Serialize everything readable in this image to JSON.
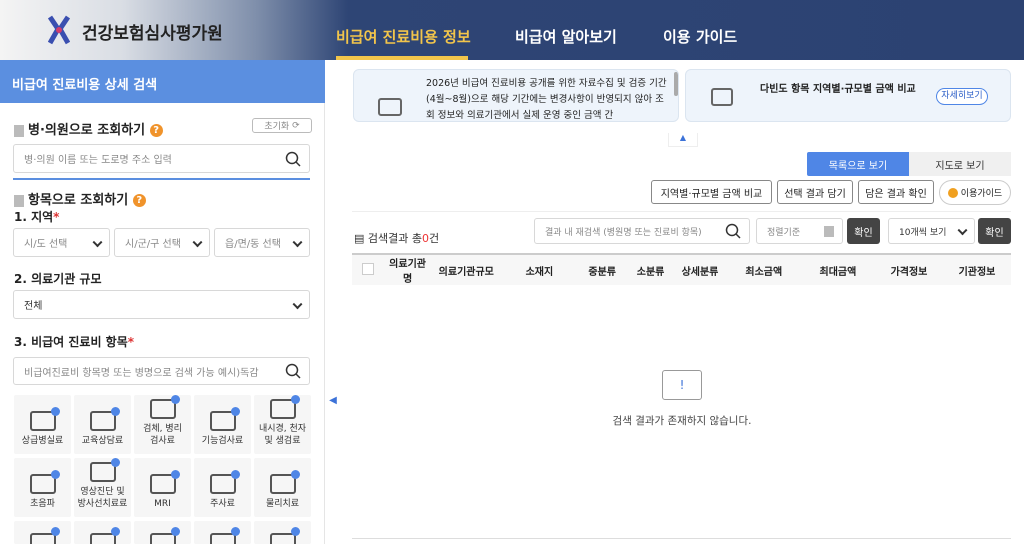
{
  "header": {
    "brand": "건강보험심사평가원",
    "nav": [
      "비급여 진료비용 정보",
      "비급여 알아보기",
      "이용 가이드"
    ]
  },
  "sidebar": {
    "title": "비급여 진료비용 상세 검색",
    "hospital_search": {
      "heading": "병·의원으로 조회하기",
      "help": "?",
      "reset": "초기화",
      "placeholder": "병·의원 이름 또는 도로명 주소 입력"
    },
    "item_search": {
      "heading": "항목으로 조회하기",
      "help": "?",
      "region_label": "1. 지역",
      "required": "*",
      "regions": [
        "시/도 선택",
        "시/군/구 선택",
        "읍/면/동 선택"
      ],
      "scale_label": "2. 의료기관 규모",
      "scale_value": "전체",
      "item_label": "3. 비급여 진료비 항목",
      "item_placeholder": "비급여진료비 항목명 또는 병명으로 검색 가능 예시)독감"
    },
    "categories": [
      "상급병실료",
      "교육상담료",
      "검체, 병리\n검사료",
      "기능검사료",
      "내시경, 천자\n및 생검료",
      "초음파",
      "영상진단 및\n방사선치료료",
      "MRI",
      "주사료",
      "물리치료",
      "",
      "",
      "",
      "",
      ""
    ]
  },
  "main": {
    "notice1": "2026년 비급여 진료비용 공개를 위한 자료수집 및 검증 기간(4월~8월)으로 해당 기간에는 변경사항이 반영되지 않아 조회 정보와 의료기관에서 실제 운영 중인 금액 간",
    "notice2": "다빈도 항목 지역별·규모별 금액 비교",
    "detail": "자세히보기",
    "view_list": "목록으로 보기",
    "view_map": "지도로 보기",
    "actions": [
      "지역별·규모별 금액 비교",
      "선택 결과 담기",
      "담은 결과 확인"
    ],
    "guide": "이용가이드",
    "result_prefix": "검색결과 총",
    "result_count": "0",
    "result_suffix": "건",
    "refine_placeholder": "결과 내 재검색 (병원명 또는 진료비 항목)",
    "sort_placeholder": "정렬기준",
    "confirm": "확인",
    "page_size": "10개씩 보기",
    "columns": [
      "의료기관명",
      "의료기관규모",
      "소재지",
      "중분류",
      "소분류",
      "상세분류",
      "최소금액",
      "최대금액",
      "가격정보",
      "기관정보"
    ],
    "empty_icon": "!",
    "empty": "검색 결과가 존재하지 않습니다."
  }
}
